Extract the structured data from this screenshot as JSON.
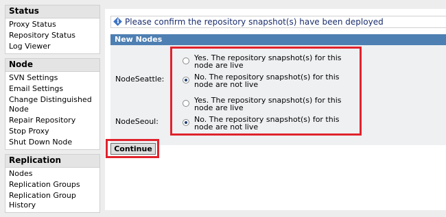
{
  "sidebar": {
    "sections": [
      {
        "title": "Status",
        "items": [
          "Proxy Status",
          "Repository Status",
          "Log Viewer"
        ]
      },
      {
        "title": "Node",
        "items": [
          "SVN Settings",
          "Email Settings",
          "Change Distinguished Node",
          "Repair Repository",
          "Stop Proxy",
          "Shut Down Node"
        ]
      },
      {
        "title": "Replication",
        "items": [
          "Nodes",
          "Replication Groups",
          "Replication Group History"
        ]
      }
    ]
  },
  "info": {
    "message": "Please confirm the repository snapshot(s) have been deployed",
    "icon": "info-icon"
  },
  "form": {
    "header": "New Nodes",
    "nodes": [
      {
        "label": "NodeSeattle:",
        "options": [
          {
            "label": "Yes. The repository snapshot(s) for this node are live",
            "checked": false
          },
          {
            "label": "No. The repository snapshot(s) for this node are not live",
            "checked": true
          }
        ]
      },
      {
        "label": "NodeSeoul:",
        "options": [
          {
            "label": "Yes. The repository snapshot(s) for this node are live",
            "checked": false
          },
          {
            "label": "No. The repository snapshot(s) for this node are not live",
            "checked": true
          }
        ]
      }
    ]
  },
  "actions": {
    "continue_label": "Continue"
  },
  "colors": {
    "panel_header": "#4e7fb2",
    "highlight": "#e0222c",
    "info_text": "#1a2e6e"
  }
}
